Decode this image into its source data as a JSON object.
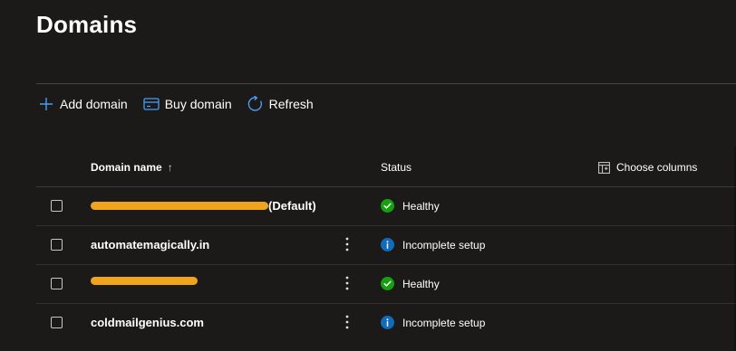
{
  "page": {
    "title": "Domains"
  },
  "toolbar": {
    "add_label": "Add domain",
    "buy_label": "Buy domain",
    "refresh_label": "Refresh"
  },
  "table": {
    "columns": {
      "name": "Domain name",
      "sort_indicator": "↑",
      "status": "Status",
      "choose_columns": "Choose columns"
    },
    "rows": [
      {
        "name": "",
        "suffix": "(Default)",
        "redacted": true,
        "status": "Healthy",
        "status_icon": "check-circle-icon"
      },
      {
        "name": "automatemagically.in",
        "suffix": "",
        "redacted": false,
        "status": "Incomplete setup",
        "status_icon": "info-circle-icon"
      },
      {
        "name": "",
        "suffix": "",
        "redacted": true,
        "status": "Healthy",
        "status_icon": "check-circle-icon"
      },
      {
        "name": "coldmailgenius.com",
        "suffix": "",
        "redacted": false,
        "status": "Incomplete setup",
        "status_icon": "info-circle-icon"
      }
    ]
  },
  "colors": {
    "background": "#1b1a19",
    "accent": "#479ef5",
    "healthy": "#13a10e",
    "info": "#0f6cbd",
    "redaction": "#f0a31c"
  }
}
